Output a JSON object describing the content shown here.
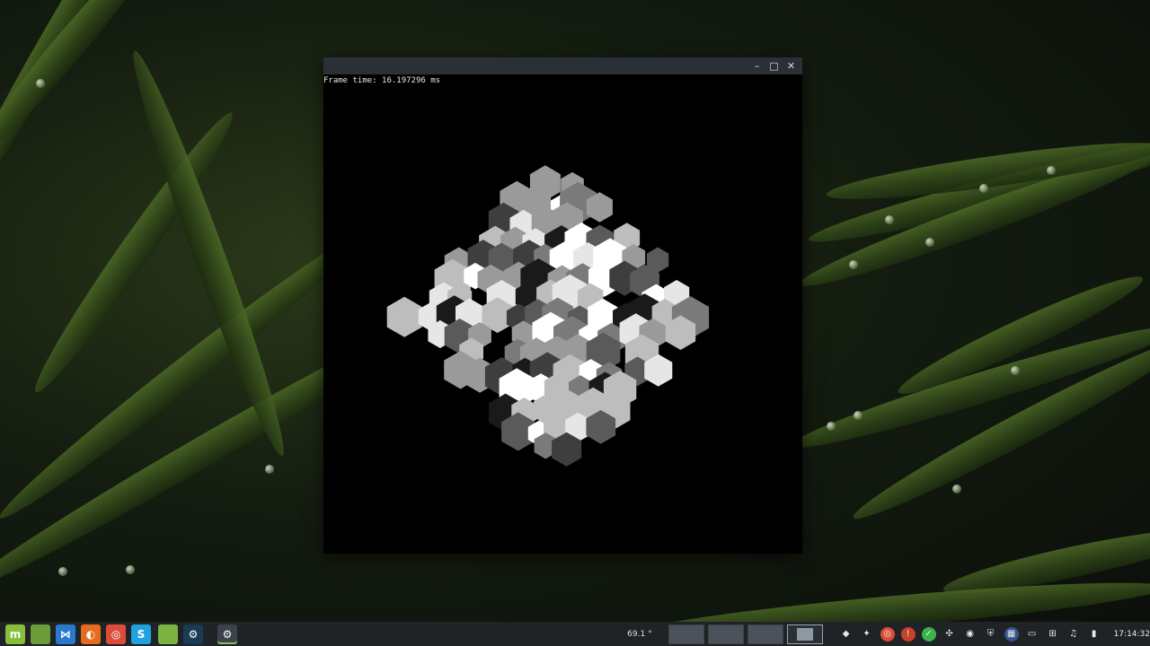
{
  "window": {
    "frame_time_text": "Frame time: 16.197296 ms",
    "controls": [
      "minimize-icon",
      "maximize-icon",
      "close-icon"
    ]
  },
  "taskbar": {
    "launchers": [
      {
        "name": "mint-menu-icon",
        "color": "#87bf3a",
        "glyph": "m"
      },
      {
        "name": "files-icon",
        "color": "#6c9b3a",
        "glyph": ""
      },
      {
        "name": "vscode-icon",
        "color": "#2a7acc",
        "glyph": "⋈"
      },
      {
        "name": "firefox-icon",
        "color": "#e56b1f",
        "glyph": "◐"
      },
      {
        "name": "chrome-icon",
        "color": "#dd4b39",
        "glyph": "◎"
      },
      {
        "name": "skype-icon",
        "color": "#1ea3e0",
        "glyph": "S"
      },
      {
        "name": "folder-icon",
        "color": "#7bb342",
        "glyph": ""
      },
      {
        "name": "steam-icon",
        "color": "#1a3b55",
        "glyph": "⚙"
      },
      {
        "name": "running-app-icon",
        "color": "#3b4249",
        "glyph": "⚙"
      }
    ],
    "temperature": "69.1 °",
    "workspaces": 4,
    "tray": [
      {
        "name": "dropbox-icon",
        "color": "#1f2326",
        "glyph": "◆"
      },
      {
        "name": "cinnamon-icon",
        "color": "#1f2326",
        "glyph": "✦"
      },
      {
        "name": "chrome-tray-icon",
        "color": "#dd4b39",
        "glyph": "◎"
      },
      {
        "name": "alert-icon",
        "color": "#c9402b",
        "glyph": "!"
      },
      {
        "name": "update-check-icon",
        "color": "#3bb44a",
        "glyph": "✓"
      },
      {
        "name": "slack-icon",
        "color": "#1f2326",
        "glyph": "✣"
      },
      {
        "name": "steam-tray-icon",
        "color": "#1f2326",
        "glyph": "◉"
      },
      {
        "name": "shield-icon",
        "color": "#1f2326",
        "glyph": "⛨"
      },
      {
        "name": "keyboard-layout-flag-icon",
        "color": "#33558c",
        "glyph": "▦"
      },
      {
        "name": "display-icon",
        "color": "#1f2326",
        "glyph": "▭"
      },
      {
        "name": "network-icon",
        "color": "#1f2326",
        "glyph": "⊞"
      },
      {
        "name": "sound-icon",
        "color": "#1f2326",
        "glyph": "♫"
      },
      {
        "name": "trash-icon",
        "color": "#1f2326",
        "glyph": "▮"
      }
    ],
    "clock": "17:14:32"
  }
}
